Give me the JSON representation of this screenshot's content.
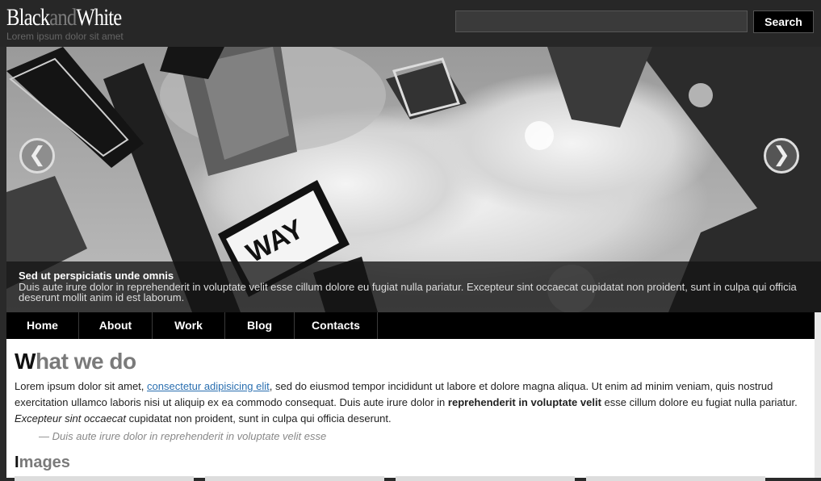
{
  "header": {
    "logo_black": "Black",
    "logo_and": "and",
    "logo_white": "White",
    "tagline": "Lorem ipsum dolor sit amet",
    "search_value": "",
    "search_button": "Search"
  },
  "slider": {
    "prev_icon": "chevron-left-icon",
    "next_icon": "chevron-right-icon",
    "sign_text": "WAY",
    "caption_title": "Sed ut perspiciatis unde omnis",
    "caption_text": "Duis aute irure dolor in reprehenderit in voluptate velit esse cillum dolore eu fugiat nulla pariatur. Excepteur sint occaecat cupidatat non proident, sunt in culpa qui officia deserunt mollit anim id est laborum."
  },
  "nav": {
    "items": [
      "Home",
      "About",
      "Work",
      "Blog",
      "Contacts"
    ]
  },
  "main": {
    "heading_first": "W",
    "heading_rest": "hat we do",
    "para_part1": "Lorem ipsum dolor sit amet, ",
    "para_link": "consectetur adipisicing elit",
    "para_part2": ", sed do eiusmod tempor incididunt ut labore et dolore magna aliqua. Ut enim ad minim veniam, quis nostrud exercitation ullamco laboris nisi ut aliquip ex ea commodo consequat. Duis aute irure dolor in ",
    "para_bold": "reprehenderit in voluptate velit",
    "para_part3": " esse cillum dolore eu fugiat nulla pariatur. ",
    "para_italic": "Excepteur sint occaecat",
    "para_part4": " cupidatat non proident, sunt in culpa qui officia deserunt.",
    "quote": "— Duis aute irure dolor in reprehenderit in voluptate velit esse",
    "images_heading_first": "I",
    "images_heading_rest": "mages"
  },
  "colors": {
    "header_bg": "#272727",
    "nav_bg": "#000000",
    "link": "#2a6fb0",
    "heading_gray": "#7a7a7a"
  }
}
